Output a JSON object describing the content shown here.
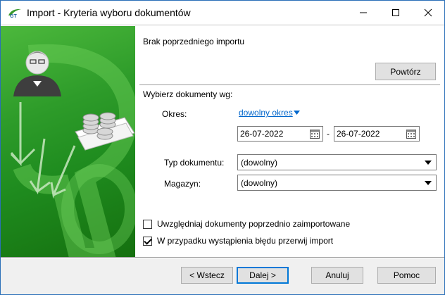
{
  "window": {
    "title": "Import - Kryteria wyboru dokumentów",
    "app_icon_letters": "GT"
  },
  "content": {
    "status": "Brak poprzedniego importu",
    "repeat_button": "Powtórz",
    "section_label": "Wybierz dokumenty wg:",
    "period": {
      "label": "Okres:",
      "value": "dowolny okres",
      "date_from": "26-07-2022",
      "separator": "-",
      "date_to": "26-07-2022"
    },
    "document_type": {
      "label": "Typ dokumentu:",
      "value": "(dowolny)"
    },
    "warehouse": {
      "label": "Magazyn:",
      "value": "(dowolny)"
    },
    "checkboxes": [
      {
        "label": "Uwzględniaj dokumenty poprzednio zaimportowane",
        "checked": false
      },
      {
        "label": "W przypadku wystąpienia błędu przerwij import",
        "checked": true
      }
    ]
  },
  "footer": {
    "back": "< Wstecz",
    "next": "Dalej >",
    "cancel": "Anuluj",
    "help": "Pomoc"
  },
  "colors": {
    "side_panel_green": "#2e9c2a",
    "link_blue": "#0066cc",
    "default_button_border": "#0078d7"
  }
}
